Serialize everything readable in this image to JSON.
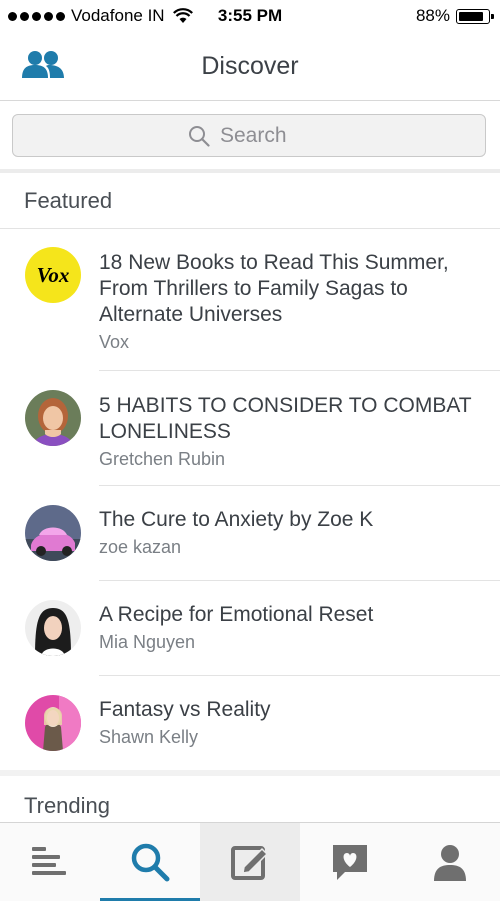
{
  "status_bar": {
    "carrier": "Vodafone IN",
    "time": "3:55 PM",
    "battery": "88%",
    "battery_level": 0.88
  },
  "header": {
    "title": "Discover"
  },
  "search": {
    "placeholder": "Search"
  },
  "featured": {
    "heading": "Featured",
    "items": [
      {
        "title": "18 New Books to Read This Summer, From Thrillers to Family Sagas to Alternate Universes",
        "author": "Vox",
        "avatar_text": "Vox"
      },
      {
        "title": "5 HABITS TO CONSIDER TO COMBAT LONELINESS",
        "author": "Gretchen Rubin"
      },
      {
        "title": "The Cure to Anxiety by Zoe K",
        "author": "zoe kazan"
      },
      {
        "title": "A Recipe for Emotional Reset",
        "author": "Mia Nguyen"
      },
      {
        "title": "Fantasy vs Reality",
        "author": "Shawn Kelly"
      }
    ]
  },
  "trending": {
    "heading": "Trending"
  },
  "tab_bar": {
    "tabs": [
      {
        "icon": "feed-icon"
      },
      {
        "icon": "search-icon",
        "active": true
      },
      {
        "icon": "compose-icon"
      },
      {
        "icon": "activity-heart-icon"
      },
      {
        "icon": "profile-icon"
      }
    ]
  },
  "colors": {
    "accent": "#1f7cab",
    "vox_yellow": "#f5e51b",
    "icon_gray": "#6f6f6f"
  }
}
